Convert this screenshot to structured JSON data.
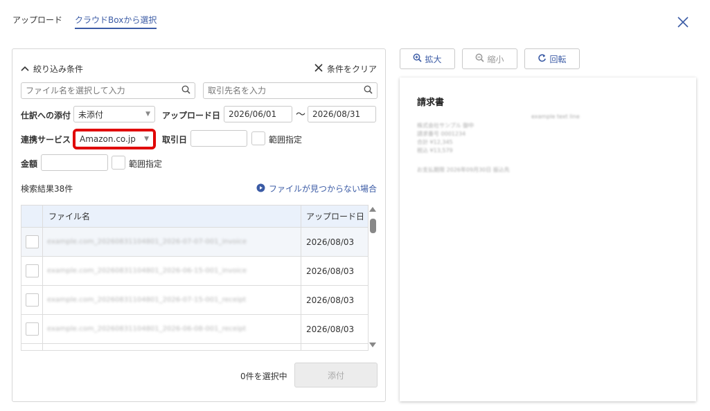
{
  "tabs": [
    {
      "label": "アップロード",
      "active": false
    },
    {
      "label": "クラウドBoxから選択",
      "active": true
    }
  ],
  "filter": {
    "toggle_label": "絞り込み条件",
    "clear_label": "条件をクリア",
    "file_search_placeholder": "ファイル名を選択して入力",
    "partner_search_placeholder": "取引先名を入力",
    "journal_label": "仕訳への添付",
    "journal_value": "未添付",
    "upload_date_label": "アップロード日",
    "upload_date_from": "2026/06/01",
    "range_sep": "〜",
    "upload_date_to": "2026/08/31",
    "service_label": "連携サービス",
    "service_value": "Amazon.co.jp",
    "trade_date_label": "取引日",
    "trade_range_label": "範囲指定",
    "amount_label": "金額",
    "amount_range_label": "範囲指定"
  },
  "results": {
    "count_label": "検索結果38件",
    "not_found_link": "ファイルが見つからない場合",
    "columns": [
      "ファイル名",
      "アップロード日"
    ],
    "rows": [
      {
        "file": "example.com_20260831104801_2026-07-07-001_invoice",
        "date": "2026/08/03"
      },
      {
        "file": "example.com_20260831104801_2026-06-15-001_invoice",
        "date": "2026/08/03"
      },
      {
        "file": "example.com_20260831104801_2026-07-15-001_receipt",
        "date": "2026/08/03"
      },
      {
        "file": "example.com_20260831104801_2026-06-08-001_receipt",
        "date": "2026/08/03"
      }
    ]
  },
  "footer": {
    "selected_label": "0件を選択中",
    "attach_label": "添付"
  },
  "viewer": {
    "zoom_in_label": "拡大",
    "zoom_out_label": "縮小",
    "rotate_label": "回転",
    "doc_title": "請求書",
    "blurred_lines": [
      "example text line",
      "株式会社サンプル 御中",
      "請求番号 0001234",
      "合計 ¥12,345",
      "税込 ¥13,579",
      "お支払期限 2026年09月30日 振込先"
    ]
  },
  "colors": {
    "accent": "#3b5ba5",
    "highlight": "#e00000",
    "table_header": "#eaf1fb"
  }
}
